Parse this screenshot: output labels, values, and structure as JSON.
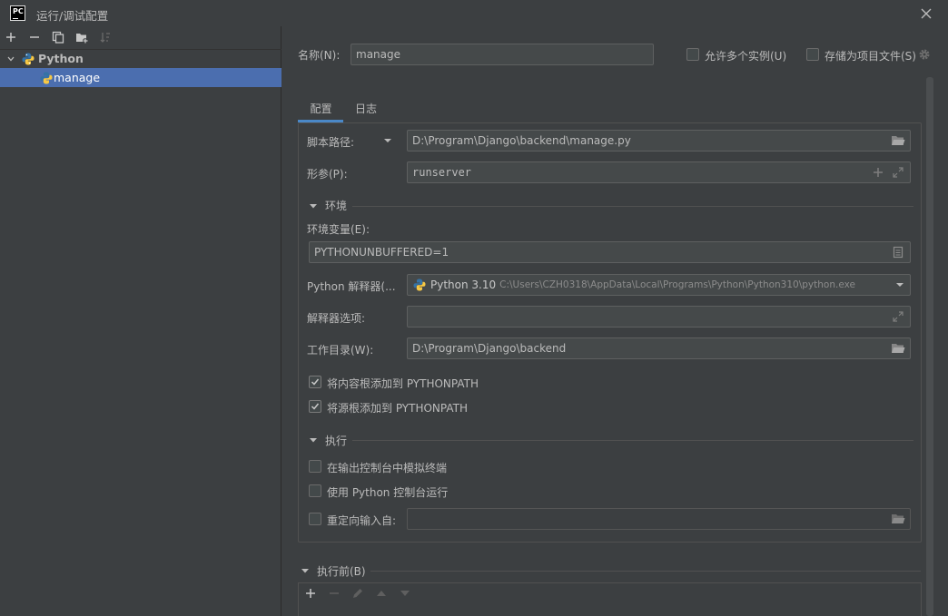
{
  "window": {
    "title": "运行/调试配置",
    "app_icon_text": "PC"
  },
  "tree": {
    "group_label": "Python",
    "item_label": "manage"
  },
  "header": {
    "name_label": "名称(N):",
    "name_value": "manage",
    "allow_parallel_label": "允许多个实例(U)",
    "store_as_file_label": "存储为项目文件(S)"
  },
  "tabs": [
    {
      "label": "配置"
    },
    {
      "label": "日志"
    }
  ],
  "form": {
    "script_path_label": "脚本路径:",
    "script_path_value": "D:\\Program\\Django\\backend\\manage.py",
    "params_label": "形参(P):",
    "params_value": "runserver",
    "env_section": "环境",
    "env_vars_label": "环境变量(E):",
    "env_vars_value": "PYTHONUNBUFFERED=1",
    "interpreter_label": "Python 解释器(...",
    "interpreter_name": "Python 3.10",
    "interpreter_path": "C:\\Users\\CZH0318\\AppData\\Local\\Programs\\Python\\Python310\\python.exe",
    "interp_options_label": "解释器选项:",
    "interp_options_value": "",
    "workdir_label": "工作目录(W):",
    "workdir_value": "D:\\Program\\Django\\backend",
    "add_content_roots_label": "将内容根添加到 PYTHONPATH",
    "add_source_roots_label": "将源根添加到 PYTHONPATH",
    "exec_section": "执行",
    "emulate_terminal_label": "在输出控制台中模拟终端",
    "python_console_label": "使用 Python 控制台运行",
    "redirect_input_label": "重定向输入自:",
    "redirect_input_value": ""
  },
  "before_launch": {
    "label": "执行前(B)"
  },
  "checks": {
    "allow_parallel": false,
    "store_as_file": false,
    "add_content_roots": true,
    "add_source_roots": true,
    "emulate_terminal": false,
    "python_console": false,
    "redirect_input": false
  },
  "colors": {
    "selection": "#4b6eaf",
    "tab_underline": "#4a88c7",
    "python_blue": "#3572a5",
    "python_yellow": "#f7c844"
  }
}
